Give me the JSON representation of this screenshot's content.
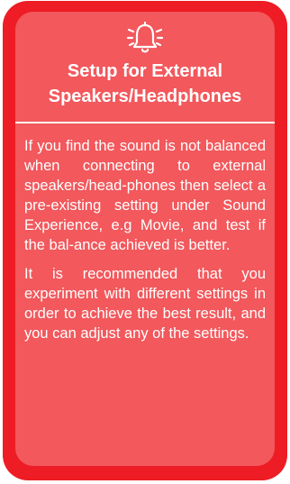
{
  "note": {
    "icon": "bell-icon",
    "title_line1": "Setup for External",
    "title_line2": "Speakers/Headphones",
    "paragraph1": "If you find the sound is not balanced when connecting to external speakers/head-phones then select a pre-existing setting under Sound Experience, e.g Movie, and test if the bal-ance achieved is better.",
    "paragraph2": "It is recommended that you experiment with different settings in order to achieve the best result, and you can adjust any of the settings."
  },
  "colors": {
    "frame": "#ee1c24",
    "panel": "#f2585c",
    "text": "#ffffff"
  }
}
